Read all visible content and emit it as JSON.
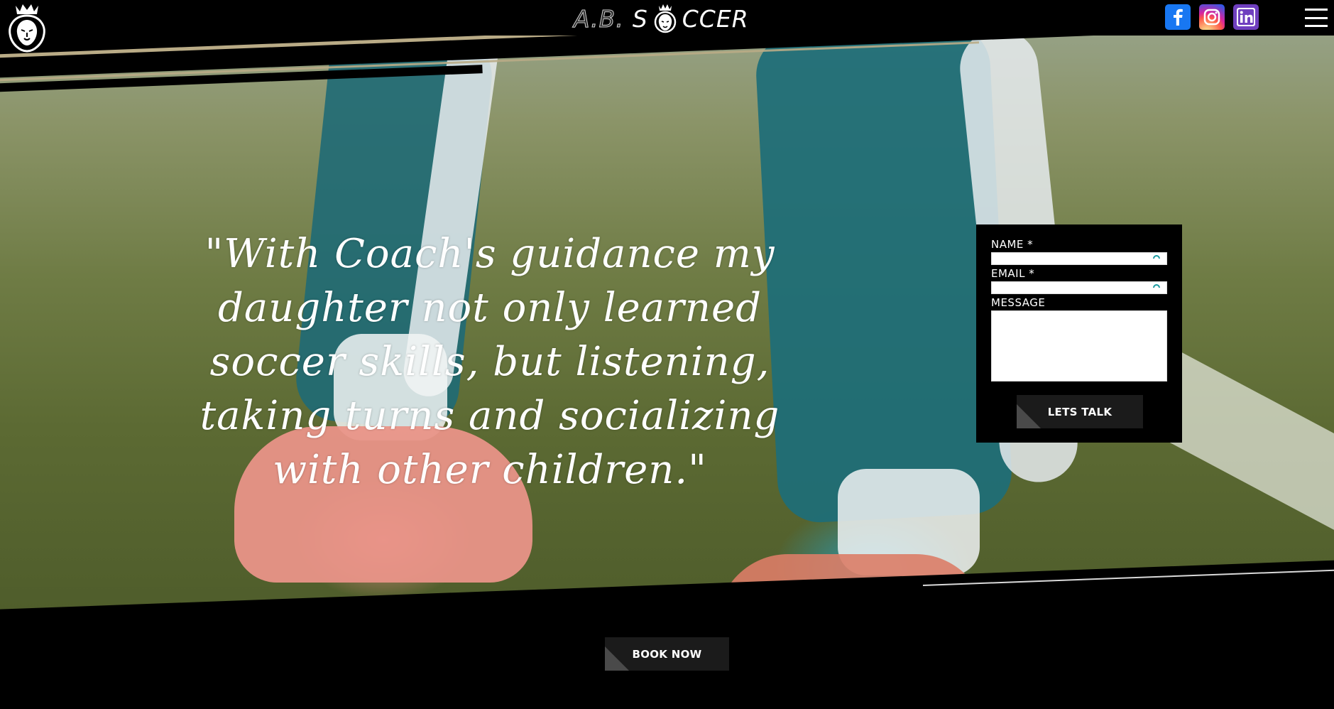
{
  "header": {
    "brand_prefix": "A.B.",
    "brand_s": "S",
    "brand_rest": "CCER",
    "social": [
      {
        "name": "facebook",
        "icon": "facebook-icon",
        "glyph": "f",
        "color": "#1877f2"
      },
      {
        "name": "instagram",
        "icon": "instagram-icon",
        "color": "#d6249f"
      },
      {
        "name": "linkedin",
        "icon": "linkedin-icon",
        "glyph": "in",
        "color": "#6f3fbf"
      }
    ]
  },
  "hero": {
    "quote": "\"With Coach's guidance my daughter not only learned soccer skills, but listening, taking turns and socializing with other children.\""
  },
  "contact_form": {
    "name_label": "NAME *",
    "email_label": "EMAIL *",
    "message_label": "MESSAGE",
    "submit_label": "LETS TALK"
  },
  "footer": {
    "book_label": "BOOK NOW"
  },
  "colors": {
    "gold": "#b9ab86",
    "button_dark": "#1b1b1b",
    "button_accent": "#4a4a4a"
  }
}
